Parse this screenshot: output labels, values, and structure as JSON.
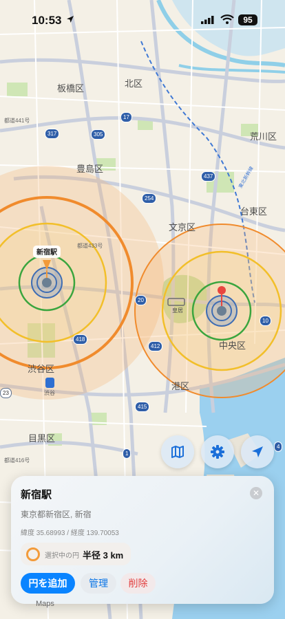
{
  "status_bar": {
    "time": "10:53",
    "battery": "95"
  },
  "map": {
    "place_labels": [
      {
        "text": "板橋区",
        "id": "itabashi"
      },
      {
        "text": "北区",
        "id": "kita"
      },
      {
        "text": "荒川区",
        "id": "arakawa"
      },
      {
        "text": "豊島区",
        "id": "toshima"
      },
      {
        "text": "台東区",
        "id": "taito"
      },
      {
        "text": "文京区",
        "id": "bunkyo"
      },
      {
        "text": "中央区",
        "id": "chuo"
      },
      {
        "text": "港区",
        "id": "minato"
      },
      {
        "text": "渋谷区",
        "id": "shibuya"
      },
      {
        "text": "目黒区",
        "id": "meguro"
      },
      {
        "text": "皇居",
        "id": "kokyo"
      },
      {
        "text": "渋谷",
        "id": "shibuya-station"
      }
    ],
    "road_labels": [
      "都道441号",
      "都道433号",
      "都道416号",
      "東北新幹線"
    ],
    "route_shields": [
      "317",
      "305",
      "17",
      "437",
      "254",
      "20",
      "418",
      "412",
      "10",
      "415",
      "1",
      "4",
      "23"
    ],
    "pins": [
      {
        "label": "新宿駅",
        "color": "#f29a3a"
      },
      {
        "label": "",
        "color": "#e8463f"
      }
    ],
    "circle_colors": {
      "outer": "#f08b2d",
      "middle": "#f2bf2a",
      "inner": "#3aa53e",
      "core": "#3f6db3"
    }
  },
  "buttons": {
    "map_icon": "map-icon",
    "settings_icon": "gear-icon",
    "location_icon": "location-arrow-icon"
  },
  "card": {
    "title": "新宿駅",
    "address": "東京都新宿区, 新宿",
    "coords": "緯度 35.68993 / 経度 139.70053",
    "selected_label": "選択中の円",
    "selected_value": "半径 3 km",
    "actions": {
      "add": "円を追加",
      "manage": "管理",
      "delete": "削除"
    }
  },
  "attribution": "Maps"
}
